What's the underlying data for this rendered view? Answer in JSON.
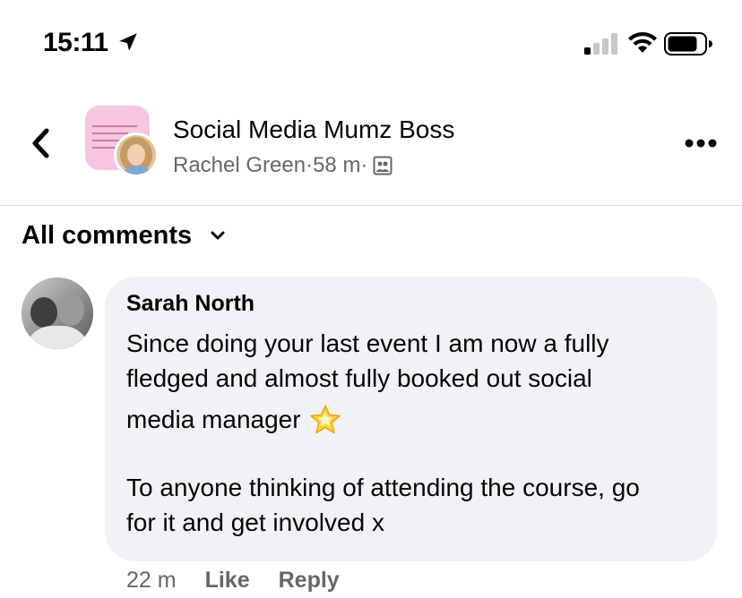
{
  "status_bar": {
    "time": "15:11",
    "icons": [
      "location-arrow-icon",
      "cellular-signal-icon",
      "wifi-icon",
      "battery-icon"
    ]
  },
  "header": {
    "group_name": "Social Media Mumz Boss",
    "author": "Rachel Green",
    "separator": " · ",
    "elapsed": "58 m",
    "audience_icon": "group-audience-icon"
  },
  "filter": {
    "label": "All comments"
  },
  "comment": {
    "author": "Sarah North",
    "lines": [
      "Since doing your last event I am now a fully",
      "fledged and almost fully booked out social",
      "media manager",
      "To anyone thinking of attending the course, go",
      "for it and get involved x"
    ],
    "emoji_icon": "glowing-star-icon",
    "time": "22 m",
    "like_label": "Like",
    "reply_label": "Reply"
  },
  "colors": {
    "text_primary": "#050505",
    "text_secondary": "#65676b",
    "bubble_bg": "#f0f2f5",
    "divider": "#dadde1"
  }
}
